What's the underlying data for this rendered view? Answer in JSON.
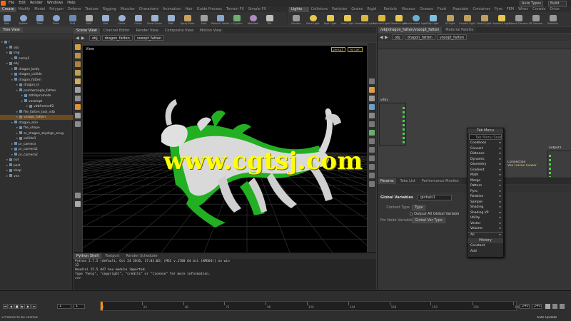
{
  "menubar": {
    "items": [
      "File",
      "Edit",
      "Render",
      "Windows",
      "Help"
    ],
    "desktop": "Auto Types",
    "search": "Build"
  },
  "shelf_left": {
    "tabs": [
      "Create",
      "Modify",
      "Model",
      "Polygon",
      "Deform",
      "Texture",
      "Rigging",
      "Muscles",
      "Characters",
      "Animation",
      "Hair",
      "Guide Process",
      "Terrain FX",
      "Simple FX"
    ],
    "tools": [
      "Box",
      "Sphere",
      "Tube",
      "Torus",
      "Grid",
      "Null",
      "Line",
      "Circle",
      "Curve",
      "Draw Curve",
      "Path",
      "Spray Paint",
      "Font",
      "Platonic Solids",
      "L-System",
      "Metaball",
      "File"
    ]
  },
  "shelf_right": {
    "tabs": [
      "Lights and Ca...",
      "Collisions",
      "Particles",
      "Grains",
      "Rigid Bodies",
      "Particle Fluids",
      "Viscous Fluids",
      "Oceans",
      "Fluid Con...",
      "Populate Cont...",
      "Container Tools",
      "Pyro FX",
      "FEM",
      "Wires",
      "Crowds",
      "Drive Simulation"
    ],
    "tools": [
      "Camera",
      "Point Light",
      "Spot Light",
      "Area Light",
      "Geometry Light",
      "Volume Light",
      "Distant Light",
      "Environment Light",
      "Sky Light",
      "GI Light",
      "Caustic Light",
      "Portal Light",
      "Ambient Light",
      "Stereo Camera",
      "VR Camera",
      "Switcher"
    ]
  },
  "left_panel": {
    "tabs": [
      "Tree View"
    ],
    "rows": [
      {
        "label": "/",
        "depth": 0
      },
      {
        "label": "obj",
        "depth": 1
      },
      {
        "label": "img",
        "depth": 1
      },
      {
        "label": "comp1",
        "depth": 2
      },
      {
        "label": "obj",
        "depth": 1
      },
      {
        "label": "dragon_body",
        "depth": 2
      },
      {
        "label": "dragon_collide",
        "depth": 2
      },
      {
        "label": "dragon_fatten",
        "depth": 2
      },
      {
        "label": "dragon_in",
        "depth": 3
      },
      {
        "label": "pointwrangle_fatten",
        "depth": 3
      },
      {
        "label": "attribpromote",
        "depth": 4
      },
      {
        "label": "voxelopt",
        "depth": 4
      },
      {
        "label": "vdbfromsdf2",
        "depth": 5
      },
      {
        "label": "file_fatten_tool_vdb",
        "depth": 3
      },
      {
        "label": "voxopt_fatten",
        "depth": 3
      },
      {
        "label": "dragon_skin",
        "depth": 2
      },
      {
        "label": "file_shape",
        "depth": 3
      },
      {
        "label": "ar_dragon_skydrgn_snug",
        "depth": 3
      },
      {
        "label": "collide1",
        "depth": 3
      },
      {
        "label": "pr_camera",
        "depth": 2
      },
      {
        "label": "pr_camera1",
        "depth": 2
      },
      {
        "label": "pr_camera2",
        "depth": 2
      },
      {
        "label": "out",
        "depth": 1
      },
      {
        "label": "part",
        "depth": 1
      },
      {
        "label": "shop",
        "depth": 1
      },
      {
        "label": "vex",
        "depth": 1
      }
    ]
  },
  "viewport_tabs": [
    "Scene View",
    "Channel Editor",
    "Render View",
    "Composite View",
    "Motion View"
  ],
  "viewport": {
    "path": [
      "obj",
      "dragon_fatten",
      "voxopt_fatten"
    ],
    "title": "View",
    "persp": "persp1",
    "cam": "no cam"
  },
  "console": {
    "tabs": [
      "Python Shell",
      "Textport",
      "Render Scheduler"
    ],
    "lines": [
      "Python 2.7.5 (default, Oct 24 2016, 17:03:02) [MSC v.1700 64 bit (AMD64)] on win",
      "32",
      "Houdini 15.5.447 hou module imported.",
      "Type \"help\", \"copyright\", \"credits\" or \"license\" for more information.",
      ">>>"
    ]
  },
  "network_panel": {
    "tabs": [
      "/obj/dragon_fatten/voxopt_fatten",
      "Material Palette"
    ],
    "path": [
      "obj",
      "dragon_fatten",
      "voxopt_fatten"
    ],
    "node_left": "vdb1",
    "node_right": "output1"
  },
  "tab_menu": {
    "title": "Tab Menu",
    "search": "Tab Menu Search",
    "items": [
      "Cookbook",
      "Convert",
      "Distance",
      "Dynamic",
      "Geometry",
      "Gradient",
      "Math",
      "Merge",
      "Pattern",
      "Pyro",
      "Relative",
      "Sample",
      "Shading",
      "Shading VP",
      "Utility",
      "Vector",
      "Volume",
      "All"
    ],
    "history_title": "History",
    "history": [
      "Constant",
      "Add"
    ]
  },
  "side_node": {
    "labels": [
      "Connection",
      "Vex Forces Viewer"
    ]
  },
  "params": {
    "tabs": [
      "Params",
      "Take List",
      "Performance Monitor"
    ],
    "header": "Global Variables",
    "node_name": "globals1",
    "fields": [
      {
        "label": "Context Type",
        "value": "Type"
      },
      {
        "label": "",
        "value": "Output All Global Variables"
      },
      {
        "label": "Por Node Variable",
        "value": "Global Var Type"
      }
    ]
  },
  "timeline": {
    "ticks": [
      "1",
      "24",
      "48",
      "72",
      "96",
      "120",
      "144",
      "168",
      "192",
      "216",
      "240"
    ],
    "start": "1",
    "end": "240",
    "current": "1",
    "end_frame": "240",
    "status": "2 frames to be cached",
    "auto_update": "Auto Update",
    "zoom": "24"
  },
  "watermark": {
    "text": "www.cgtsj.com"
  },
  "colors": {
    "accent": "#ff8c1a",
    "green": "#4fd04f",
    "panel": "#3a3a3a",
    "dark": "#1f1f1f"
  }
}
